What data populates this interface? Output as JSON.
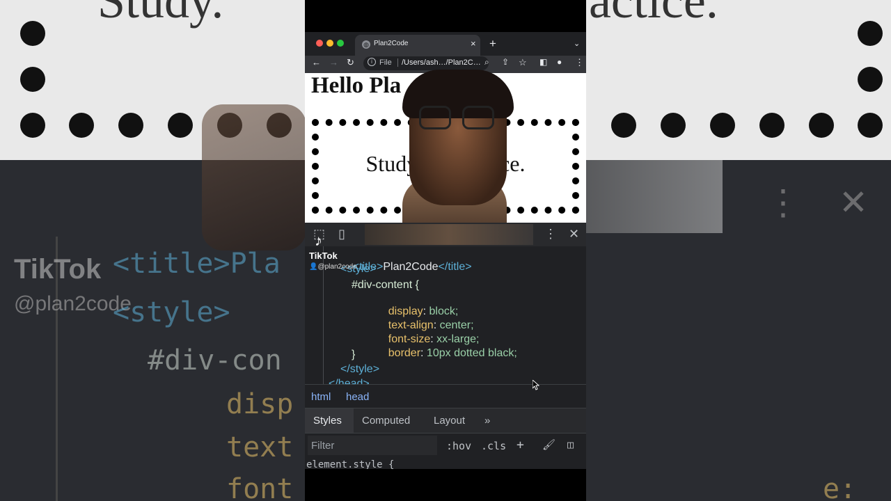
{
  "browser": {
    "tab_title": "Plan2Code",
    "tab_close": "×",
    "new_tab": "+",
    "tab_list": "⌄",
    "omnibox_scheme": "File",
    "omnibox_url": "/Users/ash…/Plan2C…"
  },
  "page": {
    "heading": "Hello Pla          .",
    "box_text": "Study. R      Practice."
  },
  "overlay": {
    "app_name": "TikTok",
    "handle": "@plan2code"
  },
  "code": {
    "l1_open": "<title>",
    "l1_text": "Plan2Code",
    "l1_close": "</title>",
    "l2": "<style>",
    "l3": "#div-content {",
    "l4_prop": "display",
    "l4_val": "block;",
    "l5_prop": "text-align",
    "l5_val": "center;",
    "l6_prop": "font-size",
    "l6_val": "xx-large;",
    "l7_prop": "border",
    "l7_val": "10px dotted black;",
    "l8": "}",
    "l9": "</style>",
    "l10": "</head>"
  },
  "breadcrumbs": [
    "html",
    "head"
  ],
  "styles_tabs": [
    "Styles",
    "Computed",
    "Layout",
    "»"
  ],
  "filter": {
    "placeholder": "Filter",
    "hov": ":hov",
    "cls": ".cls",
    "add": "+"
  },
  "element_style": "element.style {",
  "background": {
    "big_text_left": "Study.",
    "big_text_right": "ractice.",
    "tiktok": "TikTok",
    "handle": "@plan2code",
    "code_1": "<title>Pla",
    "code_2": "<style>",
    "code_3": "#div-con",
    "code_4": "disp",
    "code_5": "text",
    "code_6": "font",
    "code_r1": "e:"
  },
  "colors": {
    "tag": "#5db0d7",
    "property": "#e8c16b",
    "value": "#9ad0a8",
    "link": "#8ab4f8",
    "devtools_bg": "#202124"
  }
}
